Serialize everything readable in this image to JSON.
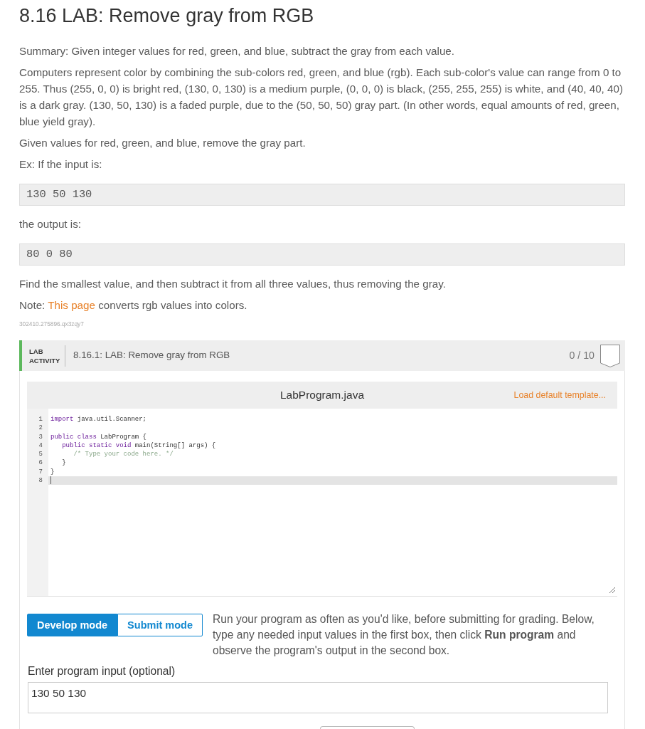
{
  "page_title": "8.16 LAB: Remove gray from RGB",
  "instructions": [
    {
      "kind": "paragraph",
      "text": "Summary: Given integer values for red, green, and blue, subtract the gray from each value."
    },
    {
      "kind": "paragraph",
      "text": "Computers represent color by combining the sub-colors red, green, and blue (rgb). Each sub-color's value can range from 0 to 255. Thus (255, 0, 0) is bright red, (130, 0, 130) is a medium purple, (0, 0, 0) is black, (255, 255, 255) is white, and (40, 40, 40) is a dark gray. (130, 50, 130) is a faded purple, due to the (50, 50, 50) gray part. (In other words, equal amounts of red, green, blue yield gray)."
    },
    {
      "kind": "paragraph",
      "text": "Given values for red, green, and blue, remove the gray part."
    },
    {
      "kind": "paragraph",
      "text": "Ex: If the input is:"
    },
    {
      "kind": "sample",
      "text": "130 50 130"
    },
    {
      "kind": "paragraph",
      "text": "the output is:"
    },
    {
      "kind": "sample",
      "text": "80 0 80"
    },
    {
      "kind": "paragraph",
      "text": "Find the smallest value, and then subtract it from all three values, thus removing the gray."
    },
    {
      "kind": "note",
      "text": "Note: ",
      "link": "This page",
      "after": " converts rgb values into colors."
    },
    {
      "kind": "tag",
      "text": "302410.275896.qx3zqy7"
    }
  ],
  "lab": {
    "tag": "LAB ACTIVITY",
    "title": "8.16.1: LAB: Remove gray from RGB",
    "score": "0 / 10",
    "completed": false,
    "editor": {
      "filename": "LabProgram.java",
      "template_link": "Load default template...",
      "lines": [
        {
          "number": "1",
          "active": false,
          "tokens": [
            {
              "kind": "keyword",
              "text": "import"
            },
            {
              "kind": "plain",
              "text": " java.util.Scanner;"
            }
          ]
        },
        {
          "number": "2",
          "active": false
        },
        {
          "number": "3",
          "active": false,
          "tokens": [
            {
              "kind": "keyword",
              "text": "public class"
            },
            {
              "kind": "plain",
              "text": " LabProgram {"
            }
          ]
        },
        {
          "number": "4",
          "active": false,
          "tokens": [
            {
              "kind": "keyword",
              "text": "   public static void"
            },
            {
              "kind": "plain",
              "text": " main(String[] args) {"
            }
          ]
        },
        {
          "number": "5",
          "active": false,
          "tokens": [
            {
              "kind": "comment",
              "text": "      /* Type your code here. */"
            }
          ]
        },
        {
          "number": "6",
          "active": false,
          "tokens": [
            {
              "kind": "plain",
              "text": "   }"
            }
          ]
        },
        {
          "number": "7",
          "active": false,
          "tokens": [
            {
              "kind": "plain",
              "text": "}"
            }
          ]
        },
        {
          "number": "8",
          "active": true
        }
      ]
    },
    "modes": [
      {
        "label": "Develop mode",
        "selected": true
      },
      {
        "label": "Submit mode",
        "selected": false
      }
    ],
    "help": "Run your program as often as you'd like, before submitting for grading. Below, type any needed input values in the first box, then click **Run program** and observe the program's output in the second box.",
    "input": {
      "label": "Enter program input (optional)",
      "value": "130 50 130"
    }
  }
}
